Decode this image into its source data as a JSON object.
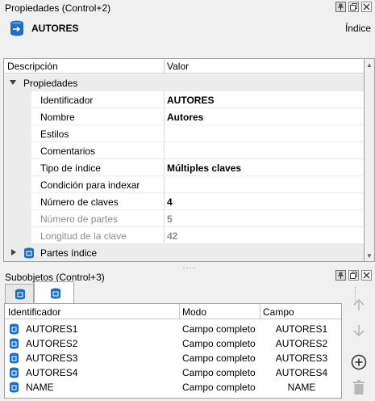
{
  "properties_panel": {
    "title": "Propiedades (Control+2)",
    "entity_name": "AUTORES",
    "entity_type": "Índice",
    "columns": {
      "description": "Descripción",
      "value": "Valor"
    },
    "group_label": "Propiedades",
    "rows": [
      {
        "label": "Identificador",
        "value": "AUTORES",
        "disabled": false
      },
      {
        "label": "Nombre",
        "value": "Autores",
        "disabled": false
      },
      {
        "label": "Estilos",
        "value": "",
        "disabled": false
      },
      {
        "label": "Comentarios",
        "value": "",
        "disabled": false
      },
      {
        "label": "Tipo de índice",
        "value": "Múltiples claves",
        "disabled": false
      },
      {
        "label": "Condición para indexar",
        "value": "",
        "disabled": false
      },
      {
        "label": "Número de claves",
        "value": "4",
        "disabled": false
      },
      {
        "label": "Número de partes",
        "value": "5",
        "disabled": true
      },
      {
        "label": "Longitud de la clave",
        "value": "42",
        "disabled": true
      }
    ],
    "collapsed_group_label": "Partes índice"
  },
  "subobjects_panel": {
    "title": "Subobjetos (Control+3)",
    "columns": {
      "identifier": "Identificador",
      "mode": "Modo",
      "field": "Campo"
    },
    "rows": [
      {
        "id": "AUTORES1",
        "mode": "Campo completo",
        "field": "AUTORES1"
      },
      {
        "id": "AUTORES2",
        "mode": "Campo completo",
        "field": "AUTORES2"
      },
      {
        "id": "AUTORES3",
        "mode": "Campo completo",
        "field": "AUTORES3"
      },
      {
        "id": "AUTORES4",
        "mode": "Campo completo",
        "field": "AUTORES4"
      },
      {
        "id": "NAME",
        "mode": "Campo completo",
        "field": "NAME"
      }
    ]
  },
  "icons": {
    "pin": "pin-icon",
    "restore": "restore-icon",
    "close": "close-icon",
    "table": "table-icon",
    "index": "index-icon",
    "move_up": "arrow-up-icon",
    "move_down": "arrow-down-icon",
    "add": "add-circle-icon",
    "delete": "trash-icon"
  },
  "colors": {
    "accent_blue": "#1e6fc0",
    "disabled_text": "#8c8c8c",
    "group_bg": "#ececec"
  }
}
